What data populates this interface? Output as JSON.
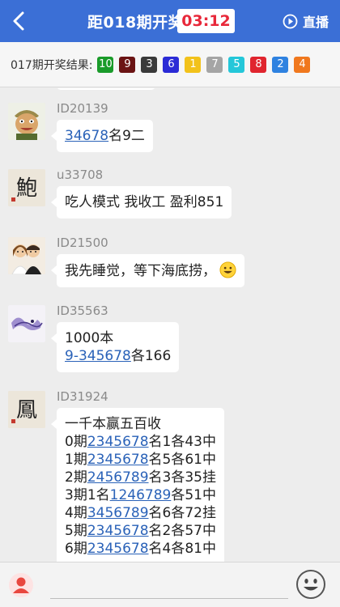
{
  "header": {
    "title": "距018期开奖",
    "timer": "03:12",
    "live_label": "直播"
  },
  "results": {
    "label": "017期开奖结果:",
    "balls": [
      {
        "number": "10",
        "color": "#1a9b2a"
      },
      {
        "number": "9",
        "color": "#6b1414"
      },
      {
        "number": "3",
        "color": "#3a3a3a"
      },
      {
        "number": "6",
        "color": "#2b2bd6"
      },
      {
        "number": "1",
        "color": "#f2c21b"
      },
      {
        "number": "7",
        "color": "#a5a5a5"
      },
      {
        "number": "5",
        "color": "#24c7d9"
      },
      {
        "number": "8",
        "color": "#e0252e"
      },
      {
        "number": "2",
        "color": "#2f82e0"
      },
      {
        "number": "4",
        "color": "#f0781e"
      }
    ]
  },
  "messages": [
    {
      "user_id": "ID20139",
      "avatar": "cartoon-man-avatar",
      "lines": [
        [
          {
            "text": "34678",
            "link": true
          },
          {
            "text": "名9二",
            "link": false
          }
        ]
      ]
    },
    {
      "user_id": "u33708",
      "avatar": "calligraphy-bao-avatar",
      "lines": [
        [
          {
            "text": "吃人模式  我收工  盈利851",
            "link": false
          }
        ]
      ]
    },
    {
      "user_id": "ID21500",
      "avatar": "couple-avatar",
      "lines": [
        [
          {
            "text": "我先睡觉，等下海底捞，",
            "link": false
          }
        ]
      ],
      "emoji": "smiley"
    },
    {
      "user_id": "ID35563",
      "avatar": "purple-sketch-avatar",
      "lines": [
        [
          {
            "text": "1000本",
            "link": false
          }
        ],
        [
          {
            "text": "9-345678",
            "link": true
          },
          {
            "text": "各166",
            "link": false
          }
        ]
      ]
    },
    {
      "user_id": "ID31924",
      "avatar": "calligraphy-feng-avatar",
      "lines": [
        [
          {
            "text": "一千本赢五百收",
            "link": false
          }
        ],
        [
          {
            "text": "0期",
            "link": false
          },
          {
            "text": "2345678",
            "link": true
          },
          {
            "text": "名1各43中",
            "link": false
          }
        ],
        [
          {
            "text": "1期",
            "link": false
          },
          {
            "text": "2345678",
            "link": true
          },
          {
            "text": "名5各61中",
            "link": false
          }
        ],
        [
          {
            "text": "2期",
            "link": false
          },
          {
            "text": "2456789",
            "link": true
          },
          {
            "text": "名3各35挂",
            "link": false
          }
        ],
        [
          {
            "text": "3期1名",
            "link": false
          },
          {
            "text": "1246789",
            "link": true
          },
          {
            "text": "各51中",
            "link": false
          }
        ],
        [
          {
            "text": "4期",
            "link": false
          },
          {
            "text": "3456789",
            "link": true
          },
          {
            "text": "名6各72挂",
            "link": false
          }
        ],
        [
          {
            "text": "5期",
            "link": false
          },
          {
            "text": "2345678",
            "link": true
          },
          {
            "text": "名2各57中",
            "link": false
          }
        ],
        [
          {
            "text": "6期",
            "link": false
          },
          {
            "text": "2345678",
            "link": true
          },
          {
            "text": "名4各81中",
            "link": false
          }
        ]
      ]
    }
  ]
}
